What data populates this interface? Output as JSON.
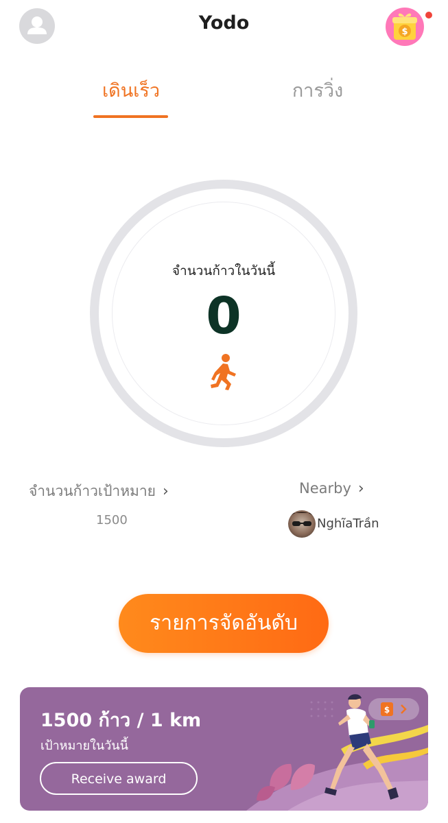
{
  "header": {
    "title": "Yodo"
  },
  "tabs": [
    {
      "label": "เดินเร็ว",
      "active": true
    },
    {
      "label": "การวิ่ง",
      "active": false
    }
  ],
  "today": {
    "label": "จำนวนก้าวในวันนี้",
    "steps": "0"
  },
  "target": {
    "label": "จำนวนก้าวเป้าหมาย",
    "value": "1500"
  },
  "nearby": {
    "label": "Nearby",
    "user_name": "NghĩaTrần"
  },
  "ranking": {
    "label": "รายการจัดอันดับ"
  },
  "banner": {
    "title": "1500 ก้าว / 1 km",
    "subtitle": "เป้าหมายในวันนี้",
    "button_label": "Receive award"
  },
  "colors": {
    "accent": "#f07322",
    "banner_bg": "#95689c",
    "notification_dot": "#f0443a"
  }
}
